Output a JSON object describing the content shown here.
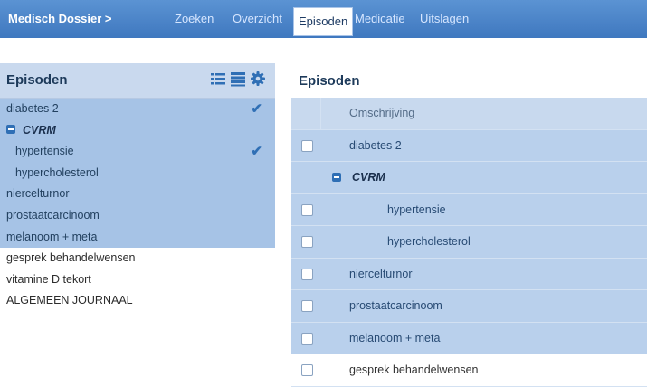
{
  "topbar": {
    "breadcrumb": "Medisch Dossier >",
    "nav": [
      {
        "label": "Zoeken"
      },
      {
        "label": "Overzicht"
      },
      {
        "label": "Episoden",
        "active": true
      },
      {
        "label": "Medicatie"
      },
      {
        "label": "Uitslagen"
      }
    ]
  },
  "sidebar": {
    "title": "Episoden",
    "icons": [
      "list-icon",
      "table-icon",
      "gear-icon"
    ],
    "items": [
      {
        "label": "diabetes 2",
        "selected": true,
        "checked": true
      },
      {
        "label": "CVRM",
        "selected": true,
        "group": true,
        "icon": "collapse-icon"
      },
      {
        "label": "hypertensie",
        "selected": true,
        "child": true,
        "checked": true
      },
      {
        "label": "hypercholesterol",
        "selected": true,
        "child": true
      },
      {
        "label": "niercelturnor",
        "selected": true
      },
      {
        "label": "prostaatcarcinoom",
        "selected": true
      },
      {
        "label": "melanoom + meta",
        "selected": true
      },
      {
        "label": "gesprek behandelwensen",
        "selected": false
      },
      {
        "label": "vitamine D tekort",
        "selected": false
      },
      {
        "label": "ALGEMEEN JOURNAAL",
        "selected": false
      }
    ]
  },
  "main": {
    "title": "Episoden",
    "column_header": "Omschrijving",
    "rows": [
      {
        "label": "diabetes 2",
        "selected": true
      },
      {
        "label": "CVRM",
        "selected": true,
        "group": true
      },
      {
        "label": "hypertensie",
        "selected": true,
        "child": true
      },
      {
        "label": "hypercholesterol",
        "selected": true,
        "child": true
      },
      {
        "label": "niercelturnor",
        "selected": true
      },
      {
        "label": "prostaatcarcinoom",
        "selected": true
      },
      {
        "label": "melanoom + meta",
        "selected": true
      },
      {
        "label": "gesprek behandelwensen",
        "selected": false
      }
    ]
  },
  "colors": {
    "topbar": "#4a85cc",
    "selected_row": "#a6c3e6",
    "header_band": "#c9d9ee",
    "accent": "#2f6fb5"
  }
}
